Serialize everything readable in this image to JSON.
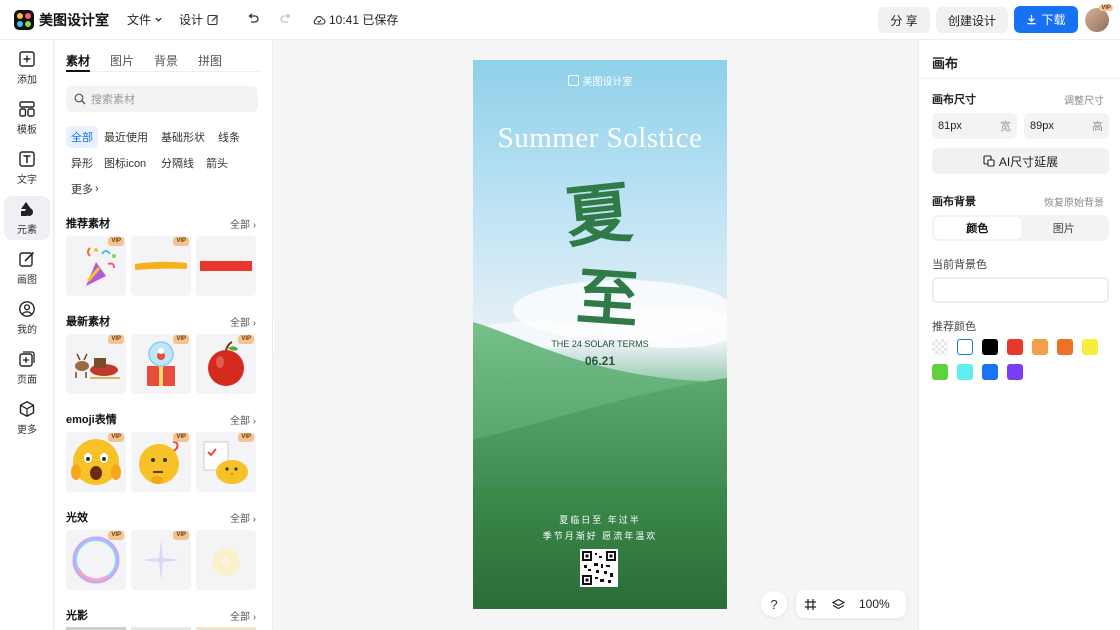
{
  "app": {
    "name": "美图设计室"
  },
  "topbar": {
    "file_menu": "文件",
    "design_menu": "设计",
    "save_status": "10:41 已保存",
    "share_label": "分 享",
    "create_label": "创建设计",
    "download_label": "下载",
    "avatar_badge": "VIP"
  },
  "leftnav": {
    "items": [
      {
        "label": "添加",
        "icon": "plus-square-icon"
      },
      {
        "label": "模板",
        "icon": "template-icon"
      },
      {
        "label": "文字",
        "icon": "text-icon"
      },
      {
        "label": "元素",
        "icon": "shapes-icon"
      },
      {
        "label": "画图",
        "icon": "draw-icon"
      },
      {
        "label": "我的",
        "icon": "user-icon"
      },
      {
        "label": "页面",
        "icon": "add-page-icon"
      },
      {
        "label": "更多",
        "icon": "cube-icon"
      }
    ],
    "active_index": 3
  },
  "panel": {
    "tabs": [
      "素材",
      "图片",
      "背景",
      "拼图"
    ],
    "active_tab": 0,
    "search_placeholder": "搜索素材",
    "chips": [
      "全部",
      "最近使用",
      "基础形状",
      "线条",
      "异形",
      "图标icon",
      "分隔线",
      "箭头",
      "更多"
    ],
    "active_chip": 0,
    "all_label": "全部",
    "vip_label": "VIP",
    "sections": [
      {
        "title": "推荐素材",
        "items": [
          "party-popper",
          "yellow-brush-stroke",
          "red-bar"
        ]
      },
      {
        "title": "最新素材",
        "items": [
          "reindeer-sleigh",
          "snow-globe-gift",
          "red-apple"
        ]
      },
      {
        "title": "emoji表情",
        "items": [
          "shocked-emoji",
          "thinking-emoji",
          "chick-checklist"
        ]
      },
      {
        "title": "光效",
        "items": [
          "rainbow-bubble",
          "star-sparkle",
          "glow-light"
        ]
      },
      {
        "title": "光影",
        "items": []
      }
    ]
  },
  "poster": {
    "brand": "美图设计室",
    "title_en": "Summer Solstice",
    "title_cn_1": "夏",
    "title_cn_2": "至",
    "subtitle": "THE 24 SOLAR TERMS",
    "date": "06.21",
    "line1": "夏临日至 年过半",
    "line2": "季节月渐好 愿流年温欢"
  },
  "canvas": {
    "zoom": "100%",
    "help": "?"
  },
  "rpanel": {
    "title": "画布",
    "size_label": "画布尺寸",
    "adjust_label": "调整尺寸",
    "width_value": "81px",
    "width_unit": "宽",
    "height_value": "89px",
    "height_unit": "高",
    "ai_extend_label": "AI尺寸延展",
    "bg_label": "画布背景",
    "restore_label": "恢复原始背景",
    "seg_color": "颜色",
    "seg_image": "图片",
    "current_bg_label": "当前背景色",
    "recommend_label": "推荐颜色",
    "colors": [
      "transparent",
      "#ffffff",
      "#000000",
      "#e8382d",
      "#f2a04b",
      "#ee7126",
      "#f7ee3c",
      "#5fd33e",
      "#5feff0",
      "#1b74f5",
      "#7c3ef4"
    ]
  }
}
